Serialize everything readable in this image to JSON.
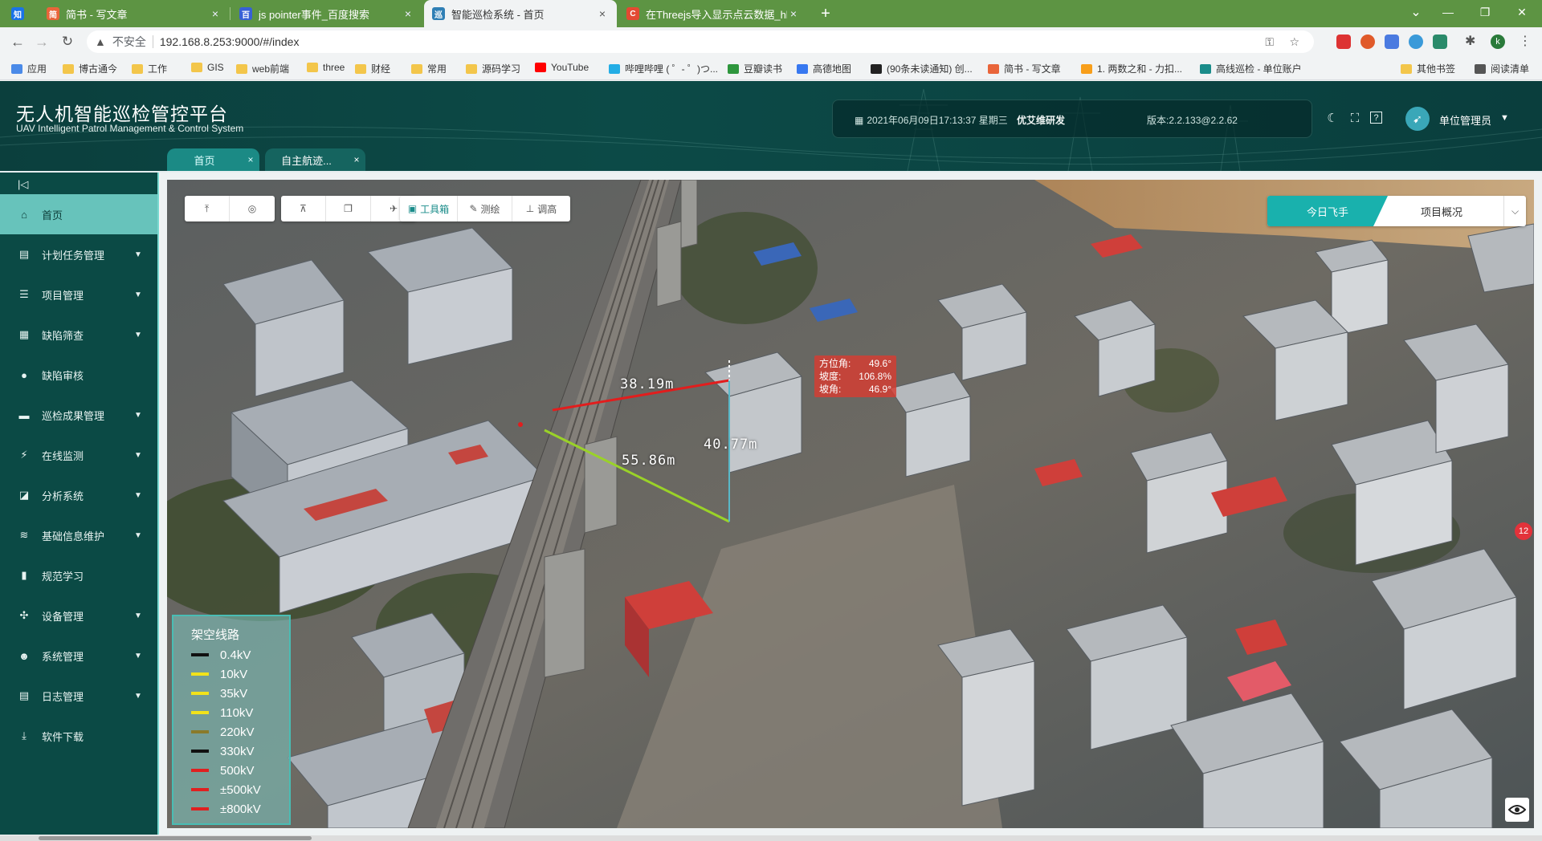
{
  "browser": {
    "tabs": [
      {
        "favicon": "知",
        "favicon_color": "#1a73e8",
        "title": "",
        "close": "×"
      },
      {
        "favicon": "简",
        "favicon_color": "#e9653a",
        "title": "简书 - 写文章",
        "close": "×"
      },
      {
        "favicon": "百",
        "favicon_color": "#3760d6",
        "title": "js pointer事件_百度搜索",
        "close": "×"
      },
      {
        "favicon": "巡",
        "favicon_color": "#2f7fb5",
        "title": "智能巡检系统 - 首页",
        "close": "×"
      },
      {
        "favicon": "C",
        "favicon_color": "#e34a32",
        "title": "在Threejs导入显示点云数据_hh",
        "close": "×"
      }
    ],
    "new_tab": "+",
    "window_controls": {
      "minimize": "—",
      "restore": "❐",
      "close": "✕"
    },
    "address": {
      "security_label": "不安全",
      "url": "192.168.8.253:9000/#/index"
    },
    "bookmarks": [
      {
        "label": "应用",
        "icon": "apps-icon"
      },
      {
        "label": "博古通今",
        "icon": "folder"
      },
      {
        "label": "工作",
        "icon": "folder"
      },
      {
        "label": "GIS",
        "icon": "folder"
      },
      {
        "label": "web前端",
        "icon": "folder"
      },
      {
        "label": "three",
        "icon": "folder"
      },
      {
        "label": "财经",
        "icon": "folder"
      },
      {
        "label": "常用",
        "icon": "folder"
      },
      {
        "label": "源码学习",
        "icon": "folder"
      },
      {
        "label": "YouTube",
        "icon": "youtube"
      },
      {
        "label": "哔哩哔哩 ( ゜- ゜)つ...",
        "icon": "bilibili"
      },
      {
        "label": "豆瓣读书",
        "icon": "douban"
      },
      {
        "label": "高德地图",
        "icon": "amap"
      },
      {
        "label": "(90条未读通知) 创...",
        "icon": "csdn"
      },
      {
        "label": "简书 - 写文章",
        "icon": "jianshu"
      },
      {
        "label": "1. 两数之和 - 力扣...",
        "icon": "leetcode"
      },
      {
        "label": "高线巡检 - 单位账户",
        "icon": "v"
      },
      {
        "label": "其他书签",
        "icon": "folder"
      },
      {
        "label": "阅读清单",
        "icon": "list"
      }
    ]
  },
  "header": {
    "title": "无人机智能巡检管控平台",
    "subtitle": "UAV Intelligent Patrol Management & Control System",
    "datetime": "2021年06月09日17:13:37 星期三",
    "developer": "优艾维研发",
    "version": "版本:2.2.133@2.2.62",
    "user": "单位管理员"
  },
  "app_tabs": [
    {
      "label": "首页",
      "close": "×"
    },
    {
      "label": "自主航迹...",
      "close": "×"
    }
  ],
  "sidebar": {
    "items": [
      {
        "label": "首页",
        "icon": "home-icon",
        "has_submenu": false,
        "active": true
      },
      {
        "label": "计划任务管理",
        "icon": "list-icon",
        "has_submenu": true
      },
      {
        "label": "项目管理",
        "icon": "server-icon",
        "has_submenu": true
      },
      {
        "label": "缺陷筛查",
        "icon": "screen-icon",
        "has_submenu": true
      },
      {
        "label": "缺陷审核",
        "icon": "user-icon",
        "has_submenu": false
      },
      {
        "label": "巡检成果管理",
        "icon": "folder-icon",
        "has_submenu": true
      },
      {
        "label": "在线监测",
        "icon": "monitor-icon",
        "has_submenu": true
      },
      {
        "label": "分析系统",
        "icon": "analysis-icon",
        "has_submenu": true
      },
      {
        "label": "基础信息维护",
        "icon": "layers-icon",
        "has_submenu": true
      },
      {
        "label": "规范学习",
        "icon": "book-icon",
        "has_submenu": false
      },
      {
        "label": "设备管理",
        "icon": "drone-icon",
        "has_submenu": true
      },
      {
        "label": "系统管理",
        "icon": "admin-icon",
        "has_submenu": true
      },
      {
        "label": "日志管理",
        "icon": "log-icon",
        "has_submenu": true
      },
      {
        "label": "软件下载",
        "icon": "download-icon",
        "has_submenu": false
      }
    ]
  },
  "map": {
    "toolbar": {
      "toolbox": "工具箱",
      "measure": "测绘",
      "adjust": "调高"
    },
    "toggle": {
      "today": "今日飞手",
      "overview": "项目概况"
    },
    "legend": {
      "title": "架空线路",
      "items": [
        {
          "label": "0.4kV",
          "color": "#111111"
        },
        {
          "label": "10kV",
          "color": "#f2e21a"
        },
        {
          "label": "35kV",
          "color": "#f2e21a"
        },
        {
          "label": "110kV",
          "color": "#f2e21a"
        },
        {
          "label": "220kV",
          "color": "#8a7a2a"
        },
        {
          "label": "330kV",
          "color": "#111111"
        },
        {
          "label": "500kV",
          "color": "#e02020"
        },
        {
          "label": "±500kV",
          "color": "#e02020"
        },
        {
          "label": "±800kV",
          "color": "#e02020"
        }
      ]
    },
    "measurements": {
      "horizontal": "38.19m",
      "slope": "55.86m",
      "vertical": "40.77m"
    },
    "angles": {
      "azimuth_label": "方位角:",
      "azimuth": "49.6°",
      "grade_label": "坡度:",
      "grade": "106.8%",
      "slope_label": "坡角:",
      "slope_angle": "46.9°"
    },
    "badge": "12"
  },
  "colors": {
    "accent": "#19b1ad",
    "sidebar": "#0b4a45",
    "active_menu": "#67c3bb"
  }
}
